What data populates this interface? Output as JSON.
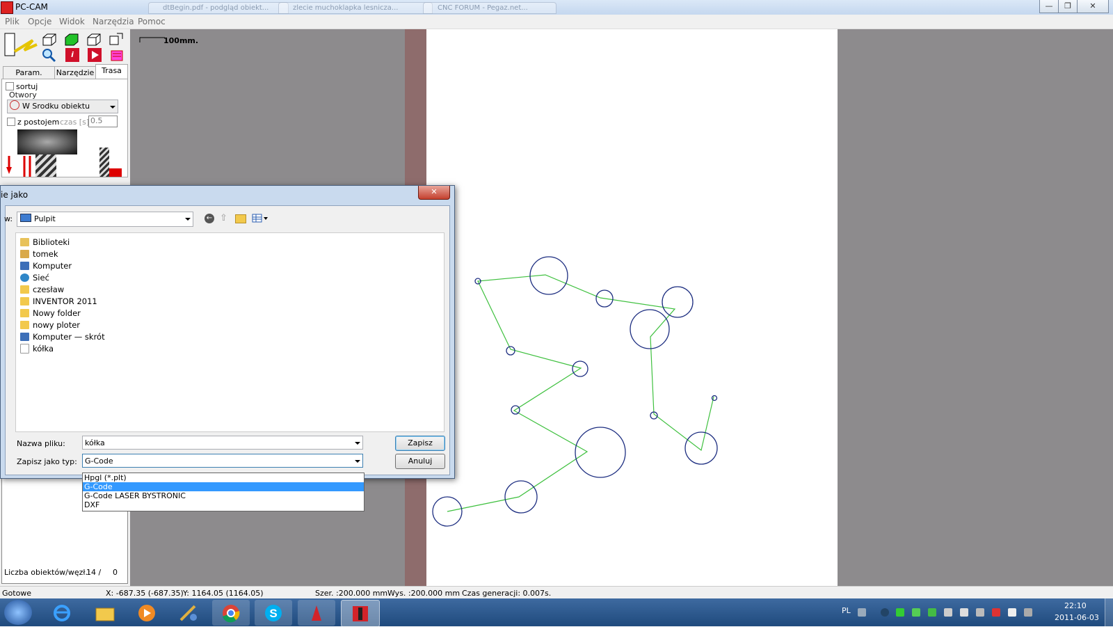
{
  "window": {
    "title": "PC-CAM",
    "min": "—",
    "max": "❐",
    "close": "✕"
  },
  "ghost_tabs": [
    "dtBegin.pdf - podgląd obiekt...",
    "zlecie muchoklapka lesnicza...",
    "CNC FORUM - Pegaz.net..."
  ],
  "menu": [
    "Plik",
    "Opcje",
    "Widok",
    "Narzędzia",
    "Pomoc"
  ],
  "left_panel": {
    "tabs": [
      "Param. mech.",
      "Narzędzie",
      "Trasa"
    ],
    "sort_label": "sortuj",
    "holes_group": "Otwory",
    "holes_select": "W Srodku obiektu",
    "dwell_label": "z postojem",
    "time_label": "czas [s]",
    "time_value": "0.5",
    "objects_label": "Liczba obiektów/węzł.:",
    "objects_value": "14 /",
    "nodes_value": "0"
  },
  "scale": "100mm.",
  "dialog": {
    "title": "ie jako",
    "location_label": "w:",
    "location_value": "Pulpit",
    "items": [
      "Biblioteki",
      "tomek",
      "Komputer",
      "Sieć",
      "czesław",
      "INVENTOR 2011",
      "Nowy folder",
      "nowy ploter",
      "Komputer — skrót",
      "kółka"
    ],
    "filename_label": "Nazwa pliku:",
    "filename_value": "kółka",
    "filetype_label": "Zapisz jako typ:",
    "filetype_value": "G-Code",
    "save_button": "Zapisz",
    "cancel_button": "Anuluj",
    "type_options": [
      "Hpgl (*.plt)",
      "G-Code",
      "G-Code LASER BYSTRONIC",
      "DXF"
    ],
    "selected_type": 1
  },
  "status": {
    "ready": "Gotowe",
    "x": "X: -687.35 (-687.35)",
    "y": "Y: 1164.05 (1164.05)",
    "width": "Szer. :200.000 mm",
    "height": "Wys. :200.000 mm",
    "gen_time": "Czas generacji: 0.007s."
  },
  "taskbar": {
    "lang": "PL",
    "time": "22:10",
    "date": "2011-06-03"
  },
  "colors": {
    "circle": "#1c2d80",
    "path": "#3ec03e",
    "workspace": "#8d8b8d",
    "selection": "#3399ff"
  }
}
